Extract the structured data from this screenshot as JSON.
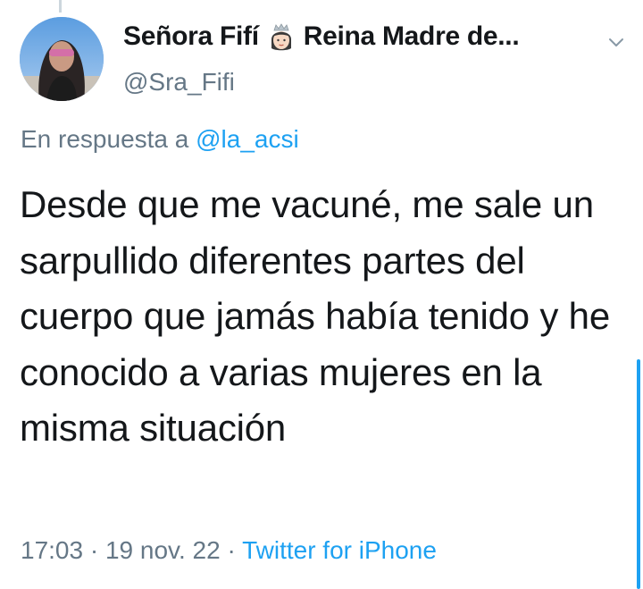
{
  "tweet": {
    "display_name": "Señora Fifí",
    "display_name_suffix": "Reina Madre de...",
    "emoji": "princess-emoji",
    "handle": "@Sra_Fifi",
    "reply_prefix": "En respuesta a",
    "reply_mention": "@la_acsi",
    "text": "Desde que me vacuné, me sale un sarpullido diferentes partes del cuerpo que jamás había tenido y he conocido a varias mujeres en la misma situación",
    "time": "17:03",
    "separator": "·",
    "date": "19 nov. 22",
    "source": "Twitter for iPhone"
  },
  "colors": {
    "text_primary": "#14171a",
    "text_secondary": "#657786",
    "accent": "#1da1f2",
    "thread_line": "#ccd6dd"
  },
  "icons": {
    "more_menu": "chevron-down-icon",
    "avatar": "avatar"
  }
}
